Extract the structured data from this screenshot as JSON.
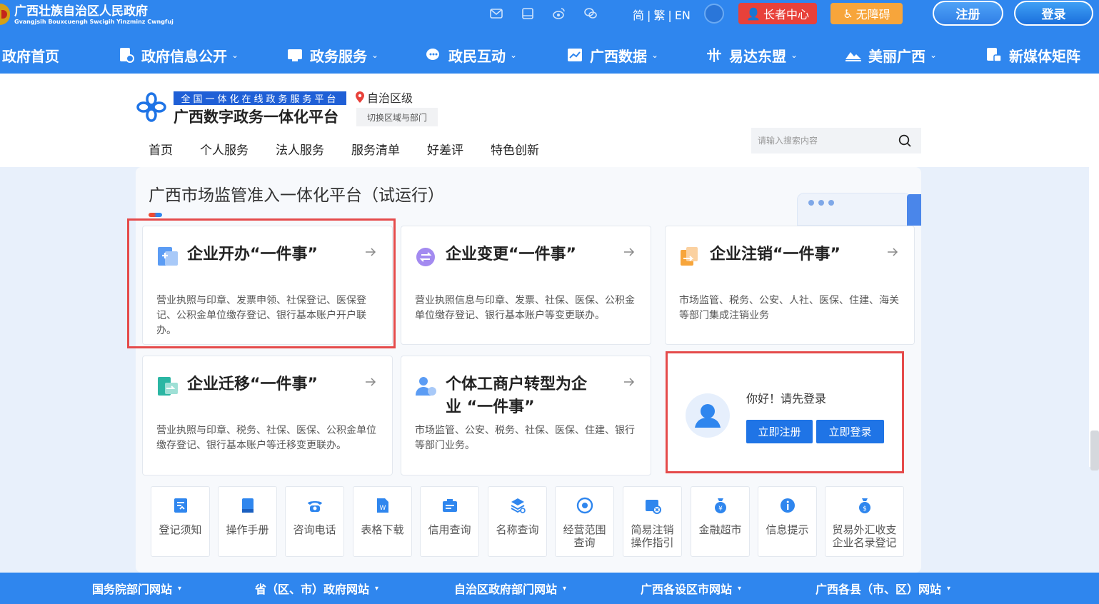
{
  "header": {
    "gov_title": "广西壮族自治区人民政府",
    "gov_subtitle": "Gvangjsih Bouxcuengh Swcigih Yinzminz Cwngfuj",
    "lang": {
      "simplified": "简",
      "traditional": "繁",
      "english": "EN",
      "sep": "|"
    },
    "elder_label": "长者中心",
    "accessibility_label": "无障碍",
    "register_label": "注册",
    "login_label": "登录",
    "util_icons": [
      "mail-icon",
      "tablet-icon",
      "weibo-icon",
      "wechat-icon",
      "globe-icon"
    ]
  },
  "main_nav": [
    {
      "label": "政府首页"
    },
    {
      "label": "政府信息公开",
      "icon": "info-disclosure-icon"
    },
    {
      "label": "政务服务",
      "icon": "service-icon"
    },
    {
      "label": "政民互动",
      "icon": "chat-icon"
    },
    {
      "label": "广西数据",
      "icon": "data-icon"
    },
    {
      "label": "易达东盟",
      "icon": "asean-icon"
    },
    {
      "label": "美丽广西",
      "icon": "scenery-icon"
    },
    {
      "label": "新媒体矩阵",
      "icon": "media-icon"
    }
  ],
  "platform": {
    "tag": "全国一体化在线政务服务平台",
    "name": "广西数字政务一体化平台",
    "region": "自治区级",
    "switch_label": "切换区域与部门"
  },
  "sub_nav": [
    "首页",
    "个人服务",
    "法人服务",
    "服务清单",
    "好差评",
    "特色创新"
  ],
  "search": {
    "placeholder": "请输入搜索内容"
  },
  "section": {
    "title": "广西市场监管准入一体化平台（试运行）"
  },
  "cards": [
    {
      "title": "企业开办“一件事”",
      "desc": "营业执照与印章、发票申领、社保登记、医保登记、公积金单位缴存登记、银行基本账户开户联办。",
      "icon": "enterprise-open-icon"
    },
    {
      "title": "企业变更“一件事”",
      "desc": "营业执照信息与印章、发票、社保、医保、公积金单位缴存登记、银行基本账户等变更联办。",
      "icon": "enterprise-change-icon"
    },
    {
      "title": "企业注销“一件事”",
      "desc": "市场监管、税务、公安、人社、医保、住建、海关等部门集成注销业务",
      "icon": "enterprise-cancel-icon"
    },
    {
      "title": "企业迁移“一件事”",
      "desc": "营业执照与印章、税务、社保、医保、公积金单位缴存登记、银行基本账户等迁移变更联办。",
      "icon": "enterprise-move-icon"
    },
    {
      "title_line1": "个体工商户转型为企",
      "title_line2": "业 “一件事”",
      "desc": "市场监管、公安、税务、社保、医保、住建、银行等部门业务。",
      "icon": "individual-transform-icon"
    }
  ],
  "login_card": {
    "greeting": "你好！请先登录",
    "register_label": "立即注册",
    "login_label": "立即登录"
  },
  "tools": [
    {
      "label": "登记须知",
      "icon": "notice-icon"
    },
    {
      "label": "操作手册",
      "icon": "manual-icon"
    },
    {
      "label": "咨询电话",
      "icon": "phone-icon"
    },
    {
      "label": "表格下载",
      "icon": "download-icon"
    },
    {
      "label": "信用查询",
      "icon": "credit-icon"
    },
    {
      "label": "名称查询",
      "icon": "name-search-icon"
    },
    {
      "label_line1": "经营范围",
      "label_line2": "查询",
      "icon": "scope-icon"
    },
    {
      "label_line1": "简易注销",
      "label_line2": "操作指引",
      "icon": "simple-cancel-icon"
    },
    {
      "label": "金融超市",
      "icon": "finance-icon"
    },
    {
      "label": "信息提示",
      "icon": "info-icon"
    },
    {
      "label_line1": "贸易外汇收支",
      "label_line2": "企业名录登记",
      "icon": "forex-icon"
    }
  ],
  "bottom_nav": [
    "国务院部门网站",
    "省（区、市）政府网站",
    "自治区政府部门网站",
    "广西各设区市网站",
    "广西各县（市、区）网站"
  ],
  "colors": {
    "primary": "#2f86ee",
    "button": "#1f74e6",
    "highlight": "#e54b4b",
    "elder": "#e8413a",
    "access": "#f7a53b"
  }
}
